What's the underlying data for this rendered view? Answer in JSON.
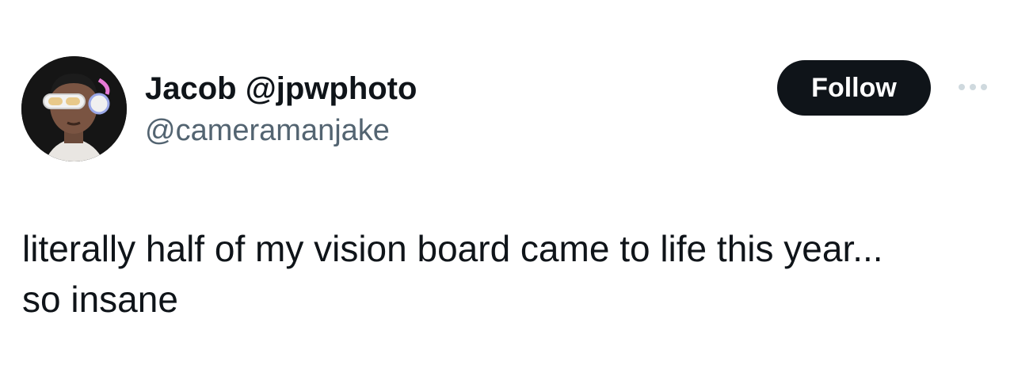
{
  "user": {
    "display_name": "Jacob @jpwphoto",
    "handle": "@cameramanjake",
    "avatar_icon": "profile-photo"
  },
  "actions": {
    "follow_label": "Follow",
    "more_icon": "more-horizontal-icon"
  },
  "tweet": {
    "text_lines": [
      "literally half of my vision board came to life this year...",
      "so insane"
    ]
  },
  "colors": {
    "text_primary": "#0f1419",
    "text_secondary": "#536471",
    "follow_bg": "#0f1419",
    "follow_text": "#ffffff",
    "more_dots": "#cfd9de"
  }
}
